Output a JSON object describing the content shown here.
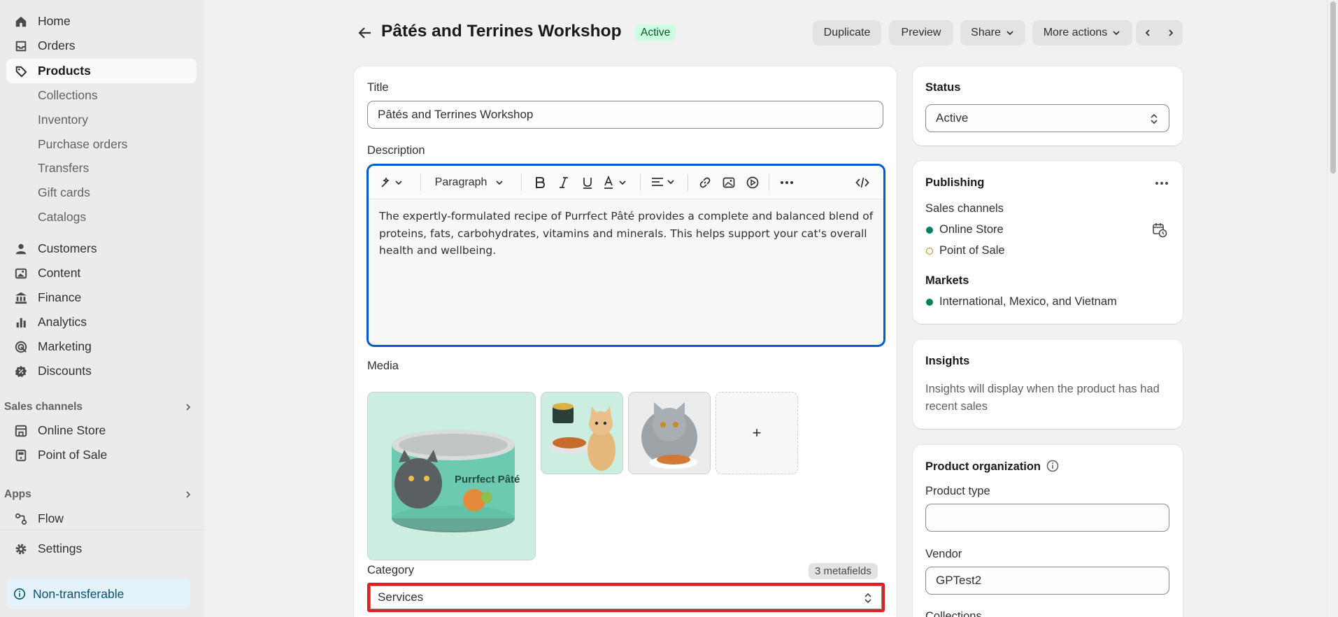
{
  "sidebar": {
    "items": [
      {
        "label": "Home",
        "icon": "home-icon"
      },
      {
        "label": "Orders",
        "icon": "inbox-icon"
      },
      {
        "label": "Products",
        "icon": "tag-icon"
      },
      {
        "label": "Collections"
      },
      {
        "label": "Inventory"
      },
      {
        "label": "Purchase orders"
      },
      {
        "label": "Transfers"
      },
      {
        "label": "Gift cards"
      },
      {
        "label": "Catalogs"
      },
      {
        "label": "Customers",
        "icon": "person-icon"
      },
      {
        "label": "Content",
        "icon": "image-icon"
      },
      {
        "label": "Finance",
        "icon": "bank-icon"
      },
      {
        "label": "Analytics",
        "icon": "bar-chart-icon"
      },
      {
        "label": "Marketing",
        "icon": "target-icon"
      },
      {
        "label": "Discounts",
        "icon": "discount-icon"
      }
    ],
    "sales_channels_heading": "Sales channels",
    "channels": [
      {
        "label": "Online Store",
        "icon": "store-icon"
      },
      {
        "label": "Point of Sale",
        "icon": "pos-icon"
      }
    ],
    "apps_heading": "Apps",
    "apps": [
      {
        "label": "Flow",
        "icon": "flow-icon"
      }
    ],
    "settings_label": "Settings",
    "notice_label": "Non-transferable"
  },
  "header": {
    "title": "Pâtés and Terrines Workshop",
    "status_badge": "Active",
    "buttons": {
      "duplicate": "Duplicate",
      "preview": "Preview",
      "share": "Share",
      "more_actions": "More actions"
    }
  },
  "main": {
    "title_label": "Title",
    "title_value": "Pâtés and Terrines Workshop",
    "description_label": "Description",
    "editor": {
      "paragraph_select": "Paragraph",
      "content": "The expertly-formulated recipe of Purrfect Pâté provides a complete and balanced blend of proteins, fats, carbohydrates, vitamins and minerals. This helps support your cat's overall health and wellbeing."
    },
    "media_label": "Media",
    "media_can_text": "Purrfect Pâté",
    "media_add": "+",
    "category_label": "Category",
    "metafields_badge": "3 metafields",
    "category_value": "Services"
  },
  "side": {
    "status": {
      "heading": "Status",
      "value": "Active"
    },
    "publishing": {
      "heading": "Publishing",
      "sales_channels_label": "Sales channels",
      "channels": [
        {
          "label": "Online Store",
          "state": "published"
        },
        {
          "label": "Point of Sale",
          "state": "not published"
        }
      ],
      "markets_label": "Markets",
      "markets_value": "International, Mexico, and Vietnam"
    },
    "insights": {
      "heading": "Insights",
      "text": "Insights will display when the product has had recent sales"
    },
    "organization": {
      "heading": "Product organization",
      "product_type_label": "Product type",
      "product_type_value": "",
      "vendor_label": "Vendor",
      "vendor_value": "GPTest2",
      "collections_label": "Collections"
    }
  },
  "colors": {
    "accent_blue": "#005bd3",
    "highlight_red": "#e02020",
    "success_green": "#008060",
    "badge_green_bg": "#cdfee1"
  }
}
